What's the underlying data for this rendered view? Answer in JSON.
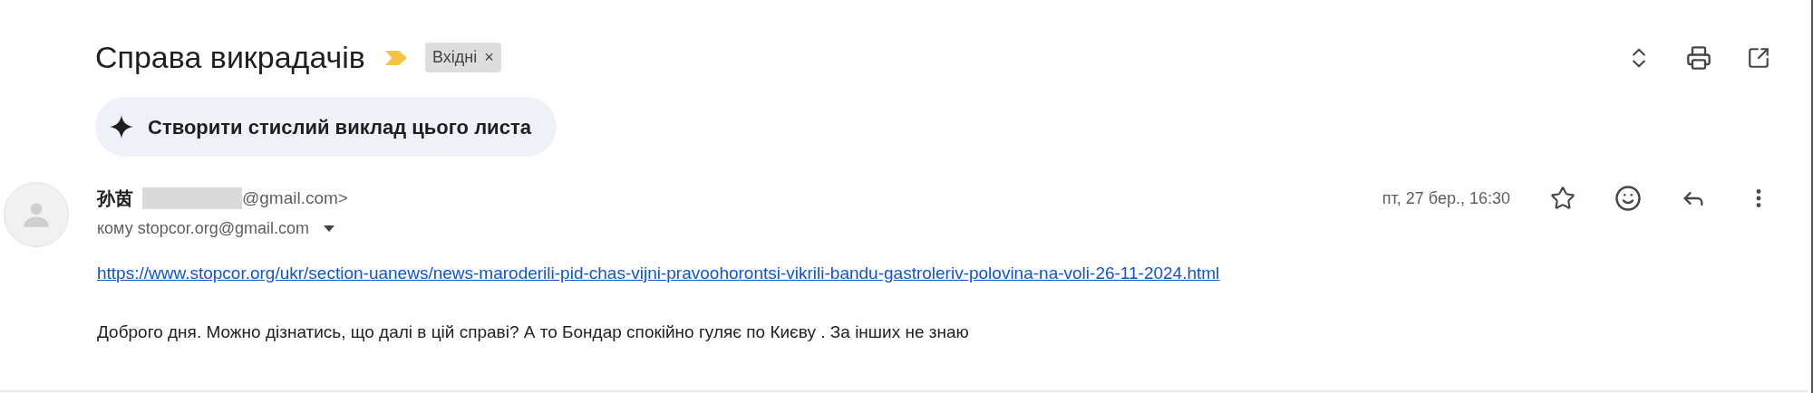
{
  "subject": "Справа викрадачів",
  "label": {
    "text": "Вхідні",
    "remove": "×"
  },
  "summary_button": "Створити стислий виклад цього листа",
  "message": {
    "sender_name": "孙茵",
    "sender_address_visible": "@gmail.com>",
    "sender_redacted": true,
    "date": "пт, 27 бер., 16:30",
    "recipient": "кому stopcor.org@gmail.com",
    "link": "https://www.stopcor.org/ukr/section-uanews/news-maroderili-pid-chas-vijni-pravoohorontsi-vikrili-bandu-gastroleriv-polovina-na-voli-26-11-2024.html",
    "body": "Доброго дня. Можно дізнатись, що далі в цій справі? А то Бондар спокійно гуляє по Києву . За інших не знаю"
  }
}
